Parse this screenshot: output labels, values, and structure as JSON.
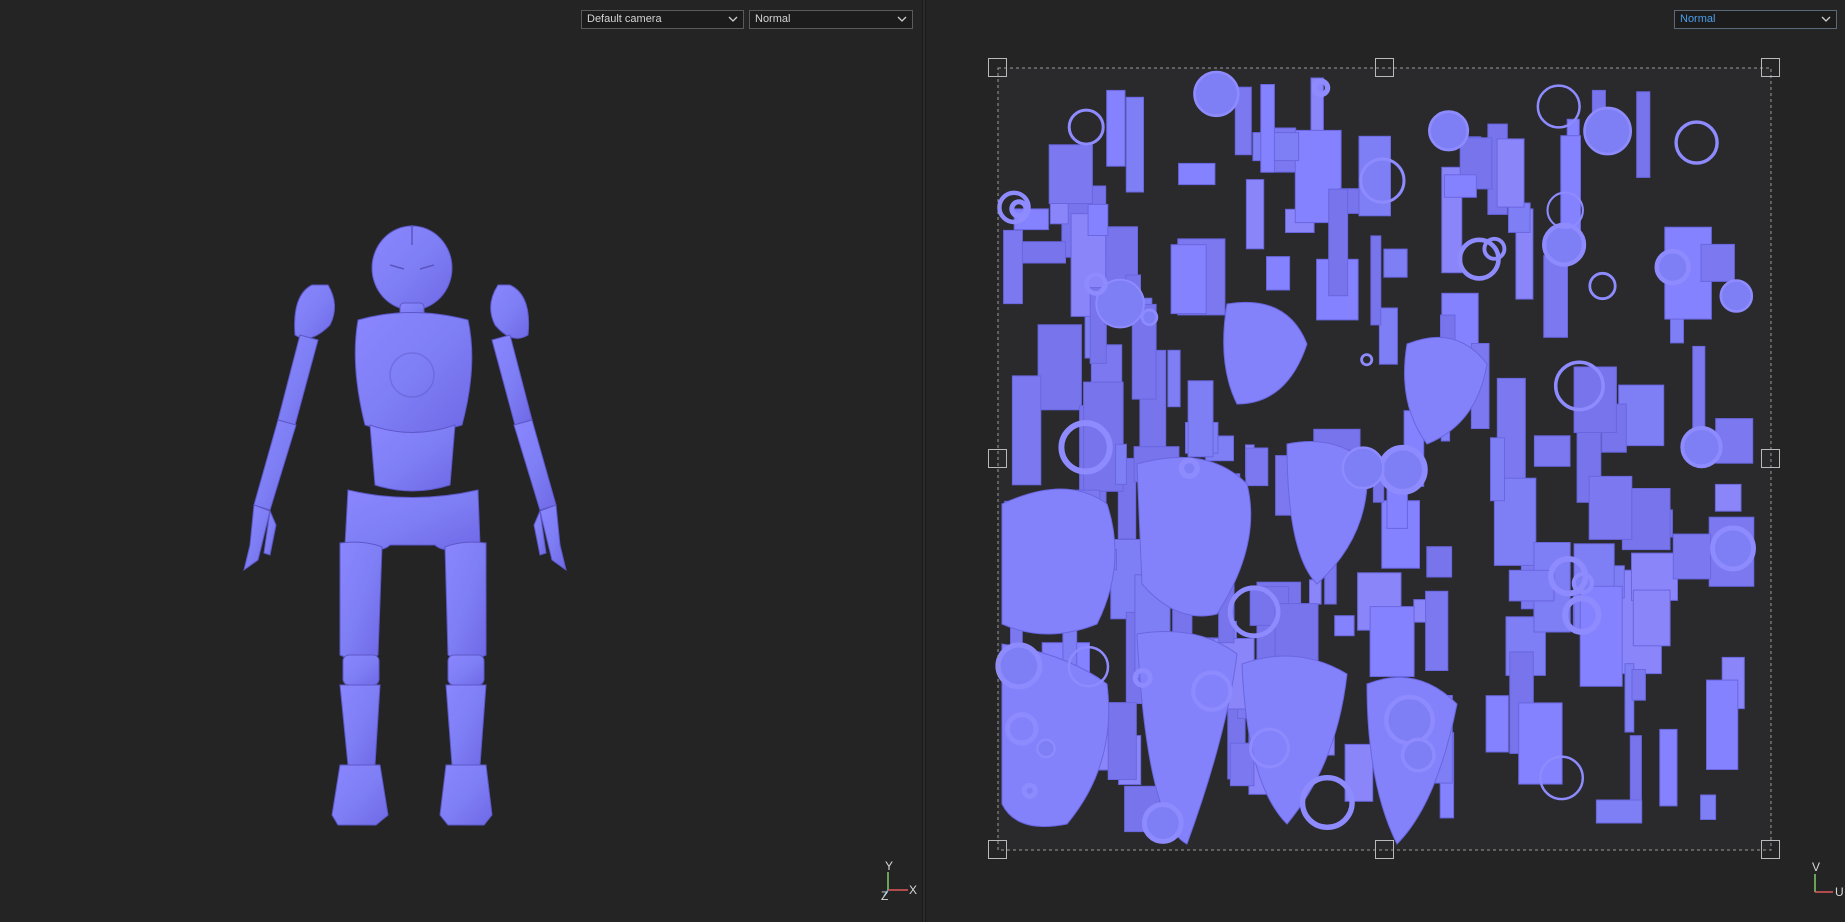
{
  "viewport3d": {
    "camera_dropdown": {
      "selected": "Default camera"
    },
    "channel_dropdown": {
      "selected": "Normal"
    },
    "gizmo": {
      "y": "Y",
      "x": "X",
      "z": "Z"
    }
  },
  "viewport2d": {
    "channel_dropdown": {
      "selected": "Normal"
    },
    "gizmo": {
      "v": "V",
      "u": "U"
    }
  },
  "colors": {
    "background": "#242425",
    "normal_base": "#7f7ff5",
    "normal_dark": "#6a66e0",
    "gizmo_x": "#e05a5a",
    "gizmo_y": "#7ecf6a",
    "gizmo_z": "#5aa0e0",
    "accent_text": "#4a9ee8"
  },
  "icons": [
    "chevron-down-icon",
    "axis-gizmo-icon",
    "uv-gizmo-icon",
    "transform-handle-icon"
  ]
}
